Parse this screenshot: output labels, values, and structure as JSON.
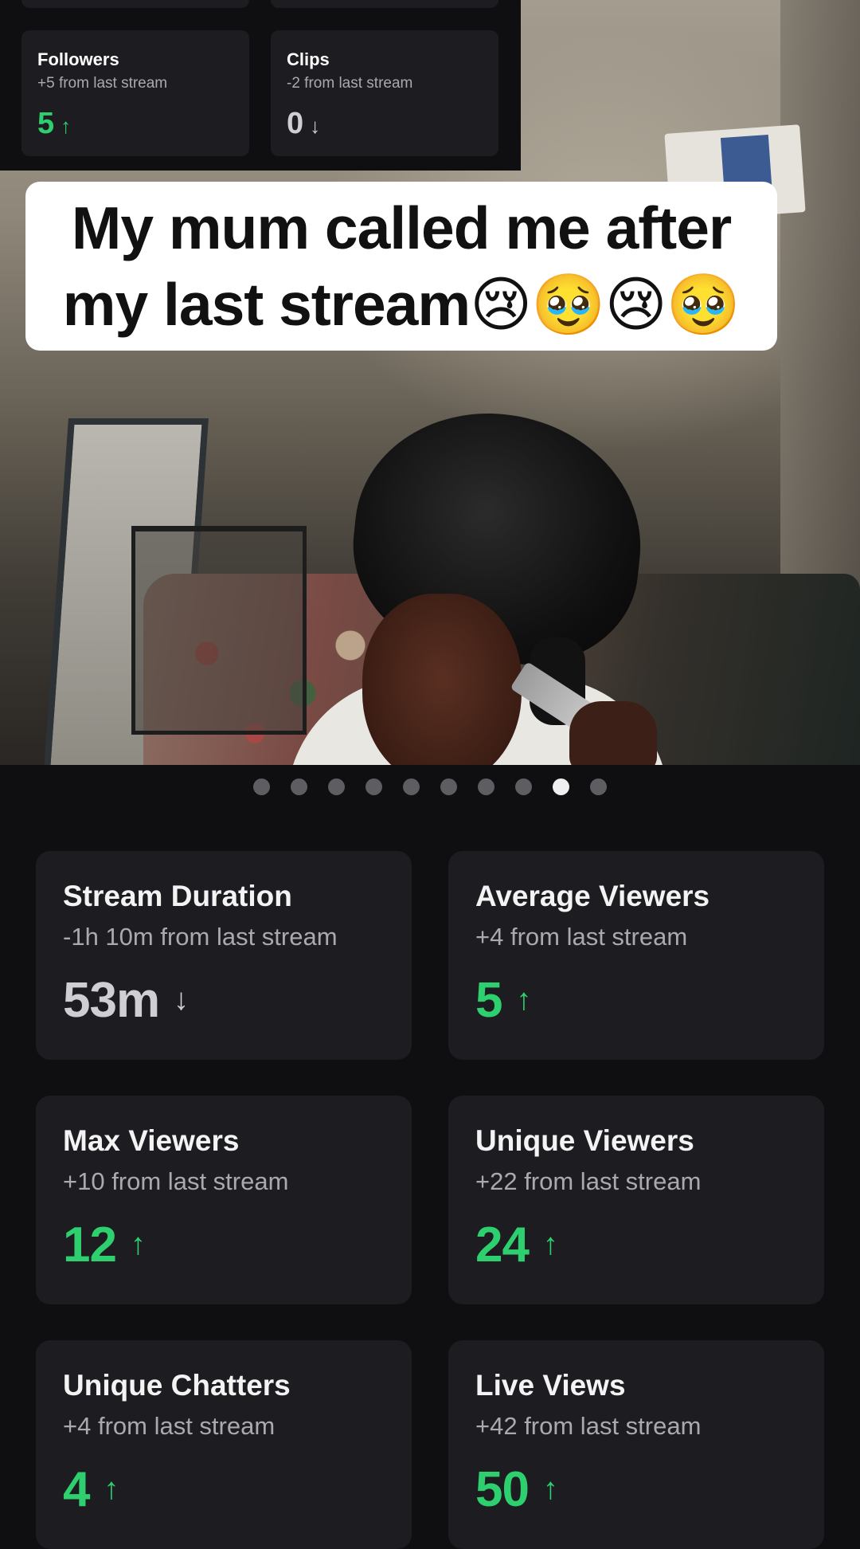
{
  "top_panel": {
    "cards": [
      {
        "title": "Followers",
        "subtitle": "+5 from last stream",
        "value": "5",
        "arrow": "↑"
      },
      {
        "title": "Clips",
        "subtitle": "-2 from last stream",
        "value": "0",
        "arrow": "↓"
      }
    ]
  },
  "caption": {
    "line1": "My mum called me after",
    "line2": "my last stream😢🥹😢🥹"
  },
  "carousel": {
    "total_dots": 10,
    "active_index": 8
  },
  "stats": [
    {
      "title": "Stream Duration",
      "subtitle": "-1h 10m from last stream",
      "value": "53m",
      "arrow": "↓",
      "trend": "down"
    },
    {
      "title": "Average Viewers",
      "subtitle": "+4 from last stream",
      "value": "5",
      "arrow": "↑",
      "trend": "up"
    },
    {
      "title": "Max Viewers",
      "subtitle": "+10 from last stream",
      "value": "12",
      "arrow": "↑",
      "trend": "up"
    },
    {
      "title": "Unique Viewers",
      "subtitle": "+22 from last stream",
      "value": "24",
      "arrow": "↑",
      "trend": "up"
    },
    {
      "title": "Unique Chatters",
      "subtitle": "+4 from last stream",
      "value": "4",
      "arrow": "↑",
      "trend": "up"
    },
    {
      "title": "Live Views",
      "subtitle": "+42 from last stream",
      "value": "50",
      "arrow": "↑",
      "trend": "up"
    }
  ],
  "colors": {
    "up": "#2ecf6e",
    "down": "#cfcfd3",
    "card_bg": "#1d1d21",
    "page_bg": "#0f0f12"
  }
}
